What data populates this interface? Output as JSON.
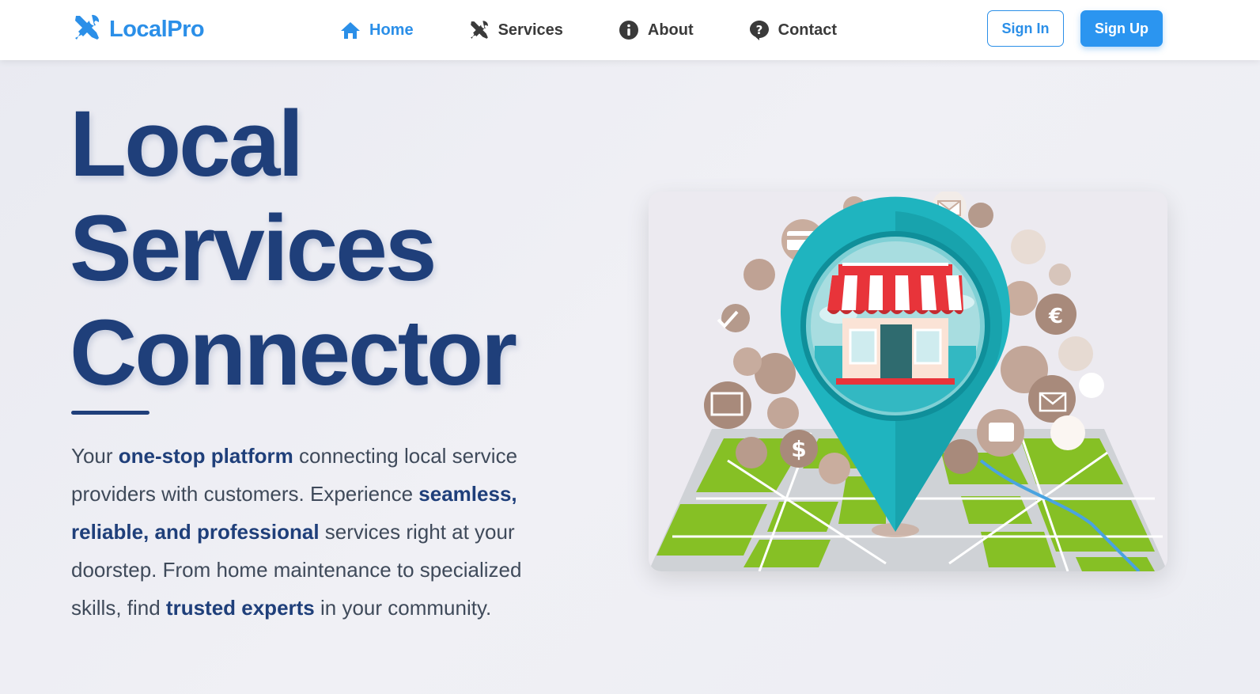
{
  "brand": {
    "name": "LocalPro",
    "color": "#2b8fe8",
    "icon": "tools-icon"
  },
  "nav": {
    "items": [
      {
        "label": "Home",
        "icon": "home-icon",
        "active": true
      },
      {
        "label": "Services",
        "icon": "tools-icon",
        "active": false
      },
      {
        "label": "About",
        "icon": "info-icon",
        "active": false
      },
      {
        "label": "Contact",
        "icon": "question-icon",
        "active": false
      }
    ]
  },
  "auth": {
    "signin_label": "Sign In",
    "signup_label": "Sign Up"
  },
  "hero": {
    "title_lines": [
      "Local",
      "Services",
      "Connector"
    ],
    "description": [
      {
        "text": "Your ",
        "bold": false
      },
      {
        "text": "one-stop platform",
        "bold": true
      },
      {
        "text": " connecting local service providers with customers. Experience ",
        "bold": false
      },
      {
        "text": "seamless, reliable, and professional",
        "bold": true
      },
      {
        "text": " services right at your doorstep. From home maintenance to specialized skills, find ",
        "bold": false
      },
      {
        "text": "trusted experts",
        "bold": true
      },
      {
        "text": " in your community.",
        "bold": false
      }
    ]
  },
  "colors": {
    "accent": "#2b8fe8",
    "title": "#1f3f7a",
    "pin": "#1fb4bf",
    "map_green": "#86c025",
    "awning_red": "#e8343a"
  }
}
